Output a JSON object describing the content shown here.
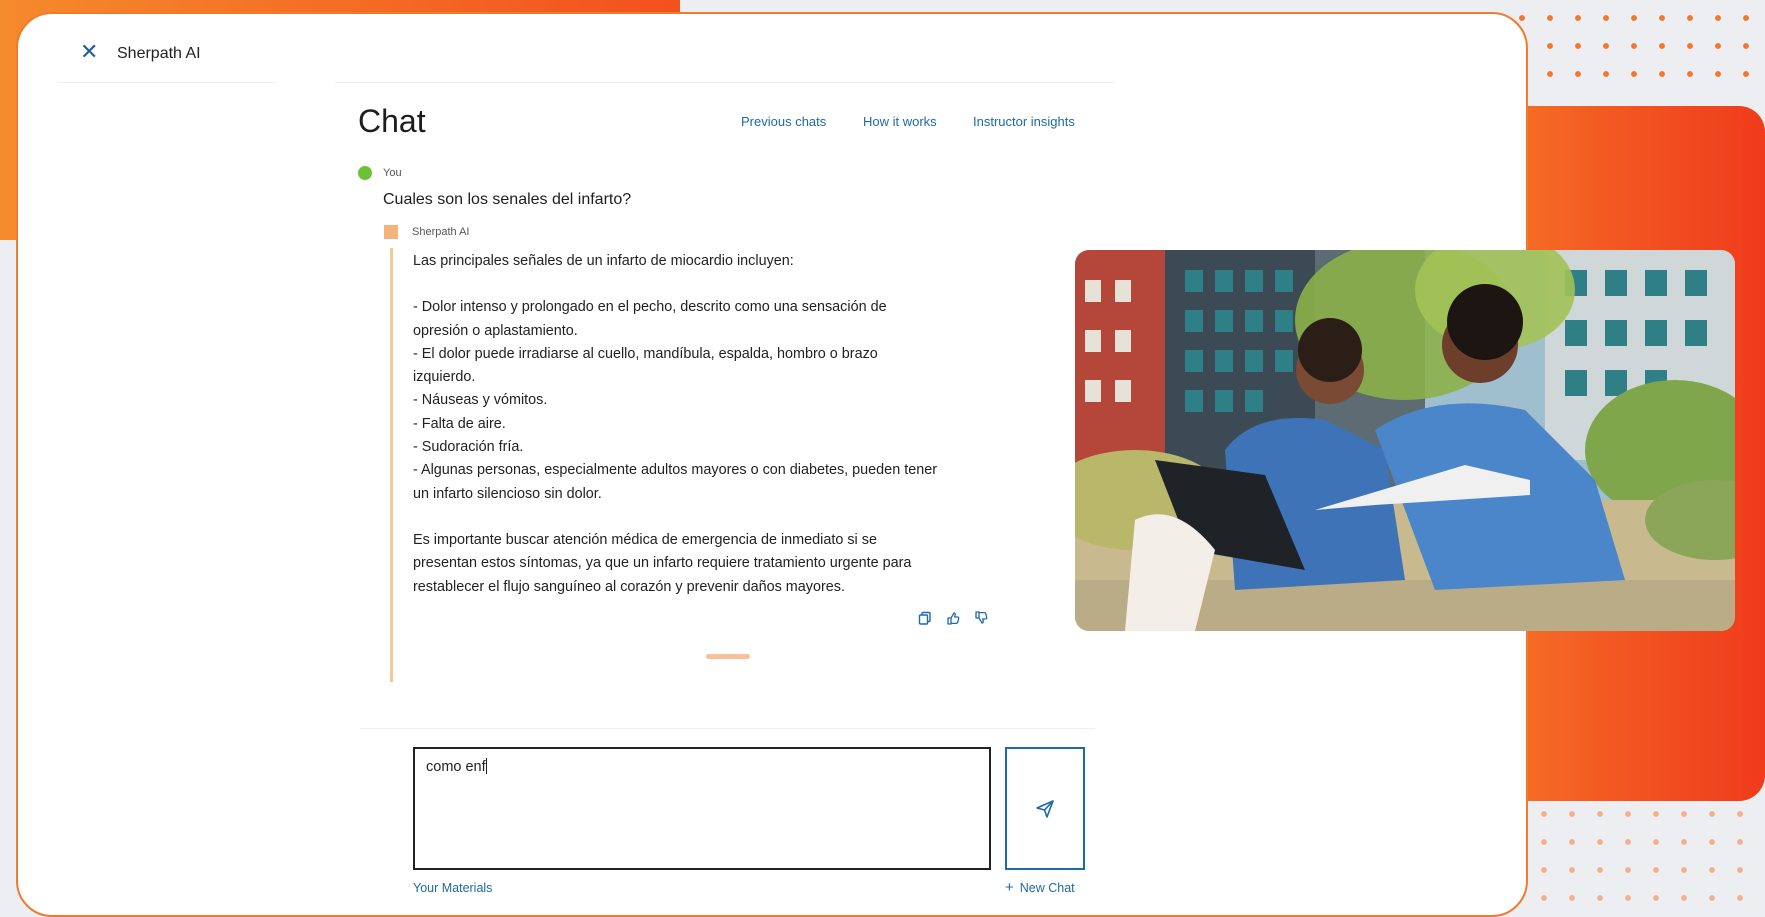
{
  "app": {
    "title": "Sherpath AI",
    "close_icon": "close-icon"
  },
  "header": {
    "title": "Chat",
    "links": [
      "Previous chats",
      "How it works",
      "Instructor insights"
    ]
  },
  "conversation": {
    "user": {
      "label": "You",
      "message": "Cuales son los senales del infarto?"
    },
    "ai": {
      "label": "Sherpath AI",
      "intro": "Las principales señales de un infarto de miocardio incluyen:",
      "bullets": [
        "- Dolor intenso y prolongado en el pecho, descrito como una sensación de",
        "opresión o aplastamiento.",
        "- El dolor puede irradiarse al cuello, mandíbula, espalda, hombro o brazo",
        "izquierdo.",
        "- Náuseas y vómitos.",
        "- Falta de aire.",
        "- Sudoración fría.",
        "- Algunas personas, especialmente adultos mayores o con diabetes, pueden tener",
        "un infarto silencioso sin dolor."
      ],
      "closing": [
        "Es importante buscar atención médica de emergencia de inmediato si se",
        "presentan estos síntomas, ya que un infarto requiere tratamiento urgente para",
        "restablecer el flujo sanguíneo al corazón y prevenir daños mayores."
      ],
      "actions": [
        "copy-icon",
        "thumbs-up-icon",
        "thumbs-down-icon"
      ]
    }
  },
  "composer": {
    "value": "como enf",
    "send_icon": "send-icon",
    "your_materials": "Your Materials",
    "new_chat": "New Chat"
  },
  "colors": {
    "accent_orange": "#f07b2e",
    "link_blue": "#1e6aa3",
    "you_dot": "#6ec136",
    "ai_square": "#f3b37a"
  }
}
